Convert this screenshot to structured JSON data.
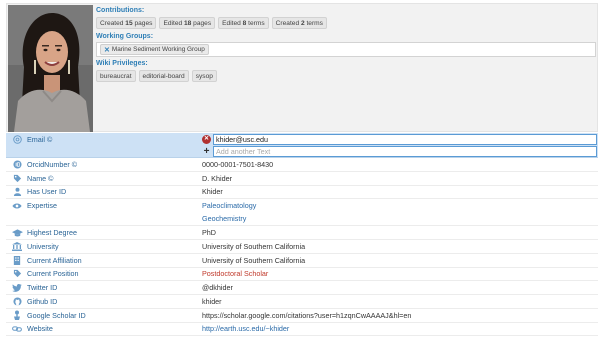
{
  "contributions": {
    "title": "Contributions:",
    "items": [
      {
        "pre": "Created ",
        "num": "15",
        "post": " pages"
      },
      {
        "pre": "Edited ",
        "num": "18",
        "post": " pages"
      },
      {
        "pre": "Edited ",
        "num": "8",
        "post": " terms"
      },
      {
        "pre": "Created ",
        "num": "2",
        "post": " terms"
      }
    ]
  },
  "working_groups": {
    "title": "Working Groups:",
    "items": [
      "Marine Sediment Working Group"
    ],
    "remove_glyph": "✕"
  },
  "wiki_privileges": {
    "title": "Wiki Privileges:",
    "items": [
      "bureaucrat",
      "editorial-board",
      "sysop"
    ]
  },
  "email": {
    "label": "Email ©",
    "value": "khider@usc.edu",
    "placeholder": "Add another Text",
    "remove_glyph": "✕",
    "add_glyph": "+"
  },
  "fields": {
    "orcid": {
      "label": "OrcidNumber ©",
      "value": "0000-0001-7501-8430"
    },
    "name": {
      "label": "Name ©",
      "value": "D. Khider"
    },
    "user_id": {
      "label": "Has User ID",
      "value": "Khider"
    },
    "expertise": {
      "label": "Expertise",
      "values": [
        "Paleoclimatology",
        "Geochemistry"
      ]
    },
    "degree": {
      "label": "Highest Degree",
      "value": "PhD"
    },
    "university": {
      "label": "University",
      "value": "University of Southern California"
    },
    "affiliation": {
      "label": "Current Affiliation",
      "value": "University of Southern California"
    },
    "position": {
      "label": "Current Position",
      "value": "Postdoctoral Scholar"
    },
    "twitter": {
      "label": "Twitter ID",
      "value": "@dkhider"
    },
    "github": {
      "label": "Github ID",
      "value": "khider"
    },
    "scholar": {
      "label": "Google Scholar ID",
      "value": "https://scholar.google.com/citations?user=h1zqnCwAAAAJ&hl=en"
    },
    "website": {
      "label": "Website",
      "value": "http://earth.usc.edu/~khider"
    }
  },
  "colors": {
    "link": "#2a6aa8",
    "label": "#2a6496",
    "highlight_row": "#cde1f5",
    "position_text": "#c0392b",
    "delete_button": "#b03030"
  }
}
